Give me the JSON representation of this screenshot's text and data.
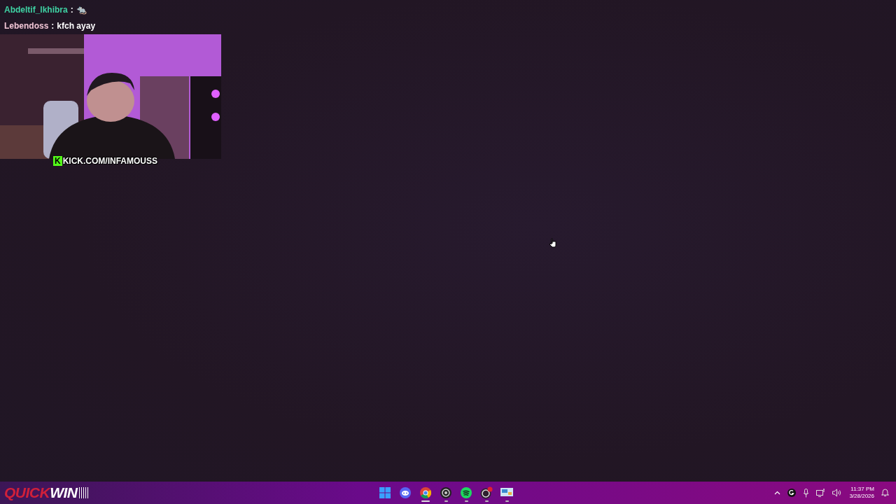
{
  "chat": [
    {
      "user": "Abdeltif_lkhibra",
      "color": "#3fd3a4",
      "separator": ":",
      "message": "🐀"
    },
    {
      "user": "Lebendoss",
      "color": "#f2c6d6",
      "separator": ":",
      "message": "kfch ayay"
    }
  ],
  "webcam": {
    "kind": "picture",
    "caption_logo": "K",
    "caption": "KICK.COM/INFAMOUSS"
  },
  "taskbar": {
    "brand": {
      "part_1": "QUICK",
      "part_2": "WIN"
    },
    "apps": [
      {
        "kind": "start",
        "running": false,
        "active": false
      },
      {
        "kind": "discord",
        "running": false,
        "active": false
      },
      {
        "kind": "chrome",
        "running": true,
        "active": true
      },
      {
        "kind": "disc",
        "running": true,
        "active": false
      },
      {
        "kind": "spotify",
        "running": true,
        "active": false
      },
      {
        "kind": "obs",
        "running": true,
        "active": false
      },
      {
        "kind": "monitor",
        "running": true,
        "active": false
      }
    ],
    "tray": {
      "time": "11:37 PM",
      "date": "3/28/2026"
    }
  }
}
